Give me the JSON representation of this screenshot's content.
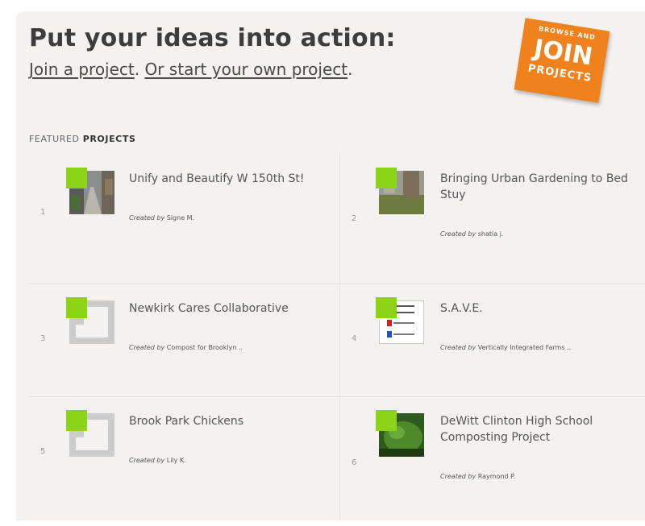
{
  "header": {
    "headline": "Put your ideas into action:",
    "join_link": "Join a project",
    "sep": ". ",
    "start_link": "Or start your own project",
    "end": "."
  },
  "badge": {
    "top": "BROWSE AND",
    "main": "JOIN",
    "bottom": "PROJECTS"
  },
  "featured": {
    "prefix": "FEATURED ",
    "bold": "PROJECTS"
  },
  "created_by_label": "Created by",
  "projects": [
    {
      "num": "1",
      "title": "Unify and Beautify W 150th St!",
      "creator": "Signe M.",
      "thumb": "street-photo"
    },
    {
      "num": "2",
      "title": "Bringing Urban Gardening to Bed Stuy",
      "creator": "shatia j.",
      "thumb": "garden-photo"
    },
    {
      "num": "3",
      "title": "Newkirk Cares Collaborative",
      "creator": "Compost for Brooklyn ..",
      "thumb": "placeholder-logo"
    },
    {
      "num": "4",
      "title": "S.A.V.E.",
      "creator": "Vertically Integrated Farms ..",
      "thumb": "save-flyer"
    },
    {
      "num": "5",
      "title": "Brook Park Chickens",
      "creator": "Lily K.",
      "thumb": "placeholder-logo"
    },
    {
      "num": "6",
      "title": "DeWitt Clinton High School Composting Project",
      "creator": "Raymond P.",
      "thumb": "leaf-photo"
    }
  ]
}
